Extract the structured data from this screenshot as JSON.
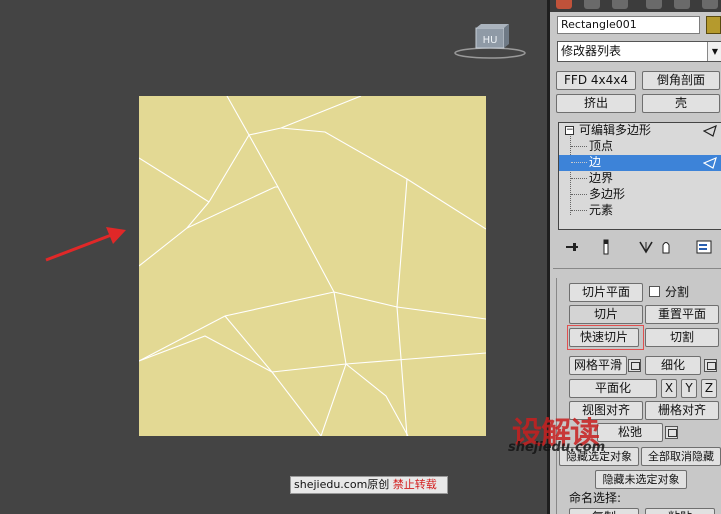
{
  "viewport": {
    "viewcube_label": "HU"
  },
  "panel": {
    "object_name": "Rectangle001",
    "object_color": "#b59a2d",
    "modifier_list": "修改器列表",
    "buttons": {
      "ffd": "FFD 4x4x4",
      "chamfer_profile": "倒角剖面",
      "extrude": "挤出",
      "shell": "壳"
    },
    "stack": {
      "root": "可编辑多边形",
      "items": [
        "顶点",
        "边",
        "边界",
        "多边形",
        "元素"
      ],
      "selected": "边"
    },
    "edit_geometry": {
      "slice_plane": "切片平面",
      "split": "分割",
      "slice": "切片",
      "reset_plane": "重置平面",
      "quickslice": "快速切片",
      "cut": "切割",
      "meshsmooth": "网格平滑",
      "tessellate": "细化",
      "planarize": "平面化",
      "x": "X",
      "y": "Y",
      "z": "Z",
      "view_align": "视图对齐",
      "grid_align": "栅格对齐",
      "relax": "松弛",
      "hide_selected": "隐藏选定对象",
      "unhide_all": "全部取消隐藏",
      "hide_unselected": "隐藏未选定对象",
      "named_selection": "命名选择:",
      "copy": "复制",
      "paste": "粘贴"
    }
  },
  "watermark": {
    "logo": "设解读",
    "url": "shejiedu.com",
    "caption_site": "shejiedu.com",
    "caption_original": "原创",
    "caption_noreprint": "禁止转载"
  },
  "colors": {
    "viewport_bg": "#444444",
    "plane_fill": "#e3d994",
    "edge_color": "#ffffff",
    "selection_blue": "#3d83d8",
    "arrow_red": "#e02828"
  }
}
